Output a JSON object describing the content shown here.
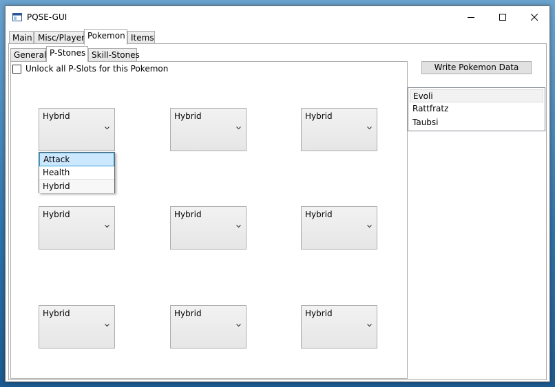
{
  "window": {
    "title": "PQSE-GUI"
  },
  "main_tabs": [
    "Main",
    "Misc/Player",
    "Pokemon",
    "Items"
  ],
  "sub_tabs": [
    "General",
    "P-Stones",
    "Skill-Stones"
  ],
  "unlock_checkbox": {
    "label": "Unlock all P-Slots for this Pokemon",
    "checked": false
  },
  "stone_slots": [
    "Hybrid",
    "Hybrid",
    "Hybrid",
    "Hybrid",
    "Hybrid",
    "Hybrid",
    "Hybrid",
    "Hybrid",
    "Hybrid"
  ],
  "dropdown_options": [
    "Attack",
    "Health",
    "Hybrid"
  ],
  "write_button": "Write Pokemon Data",
  "pokemon_list": [
    "Evoli",
    "Rattfratz",
    "Taubsi"
  ],
  "colors": {
    "selection_bg": "#cce8ff",
    "selection_border": "#26a0da",
    "button_bg": "#e1e1e1"
  }
}
